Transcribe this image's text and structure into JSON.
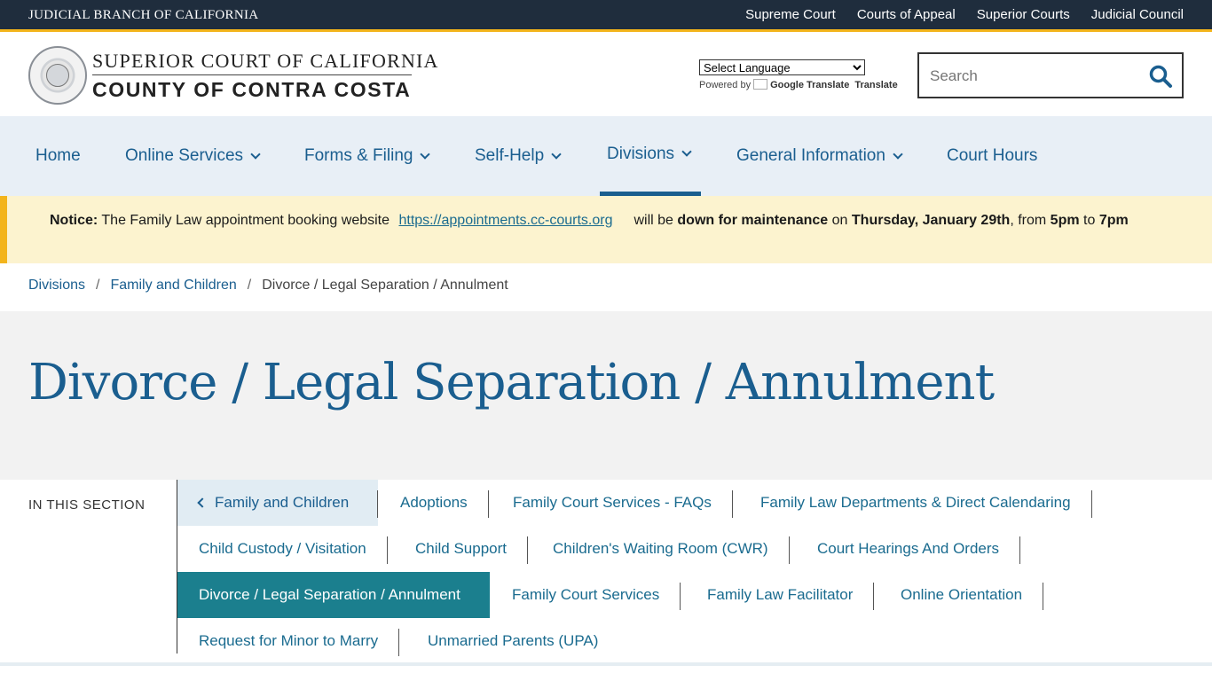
{
  "topbar": {
    "brand": "Judicial Branch of California",
    "links": [
      "Supreme Court",
      "Courts of Appeal",
      "Superior Courts",
      "Judicial Council"
    ]
  },
  "header": {
    "logo_line1": "Superior Court of California",
    "logo_line2": "County of Contra Costa",
    "language_select": "Select Language",
    "powered_by": "Powered by",
    "google_translate": "Google Translate",
    "translate": "Translate",
    "search_placeholder": "Search"
  },
  "nav": {
    "items": [
      {
        "label": "Home",
        "has_dropdown": false
      },
      {
        "label": "Online Services",
        "has_dropdown": true
      },
      {
        "label": "Forms & Filing",
        "has_dropdown": true
      },
      {
        "label": "Self-Help",
        "has_dropdown": true
      },
      {
        "label": "Divisions",
        "has_dropdown": true,
        "active": true
      },
      {
        "label": "General Information",
        "has_dropdown": true
      },
      {
        "label": "Court Hours",
        "has_dropdown": false
      }
    ]
  },
  "notice": {
    "label": "Notice:",
    "text1": "The Family Law appointment booking website",
    "link": "https://appointments.cc-courts.org",
    "text2": "will be",
    "bold1": "down for maintenance",
    "text3": "on",
    "bold2": "Thursday, January 29th",
    "text4": ", from",
    "bold3": "5pm",
    "text5": "to",
    "bold4": "7pm"
  },
  "breadcrumb": [
    "Divisions",
    "Family and Children",
    "Divorce / Legal Separation / Annulment"
  ],
  "page_title": "Divorce / Legal Separation / Annulment",
  "section_nav": {
    "heading": "In This Section",
    "back": "Family and Children",
    "links": [
      "Adoptions",
      "Family Court Services - FAQs",
      "Family Law Departments & Direct Calendaring",
      "Child Custody / Visitation",
      "Child Support",
      "Children's Waiting Room (CWR)",
      "Court Hearings And Orders",
      "Divorce / Legal Separation / Annulment",
      "Family Court Services",
      "Family Law Facilitator",
      "Online Orientation",
      "Request for Minor to Marry",
      "Unmarried Parents (UPA)"
    ],
    "current": "Divorce / Legal Separation / Annulment"
  },
  "colors": {
    "topbar_bg": "#1f2d3d",
    "accent_gold": "#f3b41b",
    "link_blue": "#1a5e8f",
    "current_teal": "#1b7f8e",
    "nav_bg": "#e8eff6",
    "notice_bg": "#fcf3cf"
  }
}
